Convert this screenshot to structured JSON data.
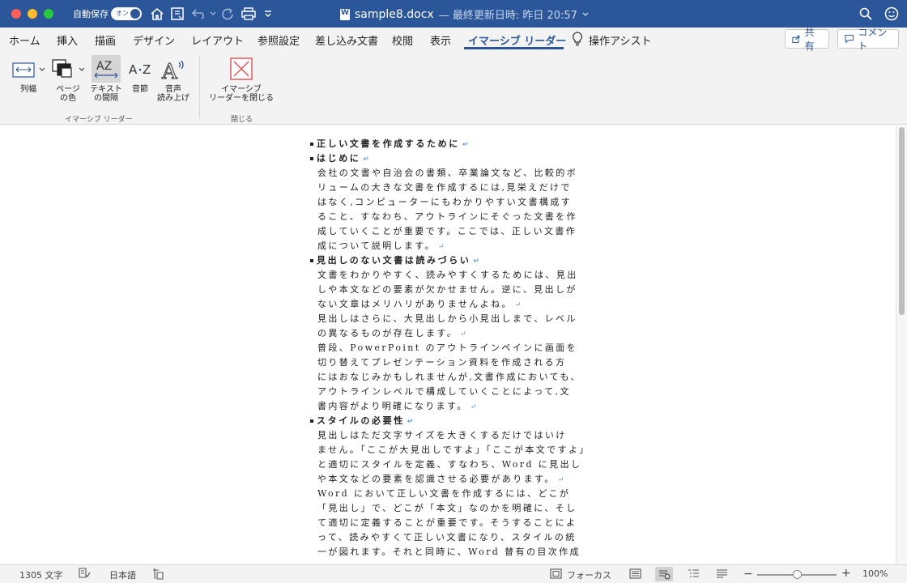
{
  "titlebar": {
    "autosave_label": "自動保存",
    "autosave_state": "オン",
    "filename": "sample8.docx",
    "meta": "— 最終更新日時: 昨日 20:57"
  },
  "tabs": [
    {
      "label": "ホーム"
    },
    {
      "label": "挿入"
    },
    {
      "label": "描画"
    },
    {
      "label": "デザイン"
    },
    {
      "label": "レイアウト"
    },
    {
      "label": "参照設定"
    },
    {
      "label": "差し込み文書"
    },
    {
      "label": "校閲"
    },
    {
      "label": "表示"
    },
    {
      "label": "イマーシブ リーダー"
    },
    {
      "label": "操作アシスト"
    }
  ],
  "actions": {
    "share_label": "共有",
    "comment_label": "コメント"
  },
  "ribbon": {
    "column_width": "列幅",
    "page_color_1": "ページ",
    "page_color_2": "の色",
    "text_spacing_1": "テキスト",
    "text_spacing_2": "の間隔",
    "syllables": "音節",
    "read_aloud_1": "音声",
    "read_aloud_2": "読み上げ",
    "close_1": "イマーシブ",
    "close_2": "リーダーを閉じる",
    "group_immersive": "イマーシブ リーダー",
    "group_close": "閉じる"
  },
  "document": {
    "lines": [
      {
        "type": "heading",
        "text": "正しい文書を作成するために"
      },
      {
        "type": "heading",
        "text": "はじめに"
      },
      {
        "type": "body",
        "text": "会社の文書や自治会の書類、卒業論文など、比較的ボ"
      },
      {
        "type": "body",
        "text": "リュームの大きな文書を作成するには,見栄えだけで"
      },
      {
        "type": "body",
        "text": "はなく,コンピューターにもわかりやすい文書構成す"
      },
      {
        "type": "body",
        "text": "ること、すなわち、アウトラインにそぐった文書を作"
      },
      {
        "type": "body",
        "text": "成していくことが重要です。ここでは、正しい文書作"
      },
      {
        "type": "body",
        "text": "成について説明します。",
        "mark": true
      },
      {
        "type": "heading",
        "text": "見出しのない文書は読みづらい"
      },
      {
        "type": "body",
        "text": "文書をわかりやすく、読みやすくするためには、見出"
      },
      {
        "type": "body",
        "text": "しや本文などの要素が欠かせません。逆に、見出しが"
      },
      {
        "type": "body",
        "text": "ない文章はメリハリがありませんよね。",
        "mark": true
      },
      {
        "type": "body",
        "text": "見出しはさらに、大見出しから小見出しまで、レベル"
      },
      {
        "type": "body",
        "text": "の異なるものが存在します。",
        "mark": true
      },
      {
        "type": "body",
        "text": "普段、PowerPoint のアウトラインペインに画面を"
      },
      {
        "type": "body",
        "text": "切り替えてプレゼンテーション資料を作成される方"
      },
      {
        "type": "body",
        "text": "にはおなじみかもしれませんが,文書作成においても、"
      },
      {
        "type": "body",
        "text": "アウトラインレベルで構成していくことによって,文"
      },
      {
        "type": "body",
        "text": "書内容がより明確になります。",
        "mark": true
      },
      {
        "type": "heading",
        "text": "スタイルの必要性"
      },
      {
        "type": "body",
        "text": "見出しはただ文字サイズを大きくするだけではいけ"
      },
      {
        "type": "body",
        "text": "ません。「ここが大見出しですよ」「ここが本文ですよ」"
      },
      {
        "type": "body",
        "text": "と適切にスタイルを定義、すなわち、Word に見出し"
      },
      {
        "type": "body",
        "text": "や本文などの要素を認識させる必要があります。",
        "mark": true
      },
      {
        "type": "body",
        "text": "Word において正しい文書を作成するには、どこが"
      },
      {
        "type": "body",
        "text": "「見出し」で、どこが「本文」なのかを明確に、そし"
      },
      {
        "type": "body",
        "text": "て適切に定義することが重要です。そうすることによ"
      },
      {
        "type": "body",
        "text": "って、読みやすくて正しい文書になり、スタイルの統"
      },
      {
        "type": "body",
        "text": "一が図れます。それと同時に、Word 替有の目次作成"
      }
    ],
    "paragraph_mark": "↵"
  },
  "statusbar": {
    "word_count": "1305 文字",
    "language": "日本語",
    "focus": "フォーカス",
    "zoom": "100%",
    "zoom_level": 0.5
  },
  "colors": {
    "accent": "#2b579a",
    "ribbon_bg": "#f3f3f3",
    "close_icon": "#e05050"
  }
}
